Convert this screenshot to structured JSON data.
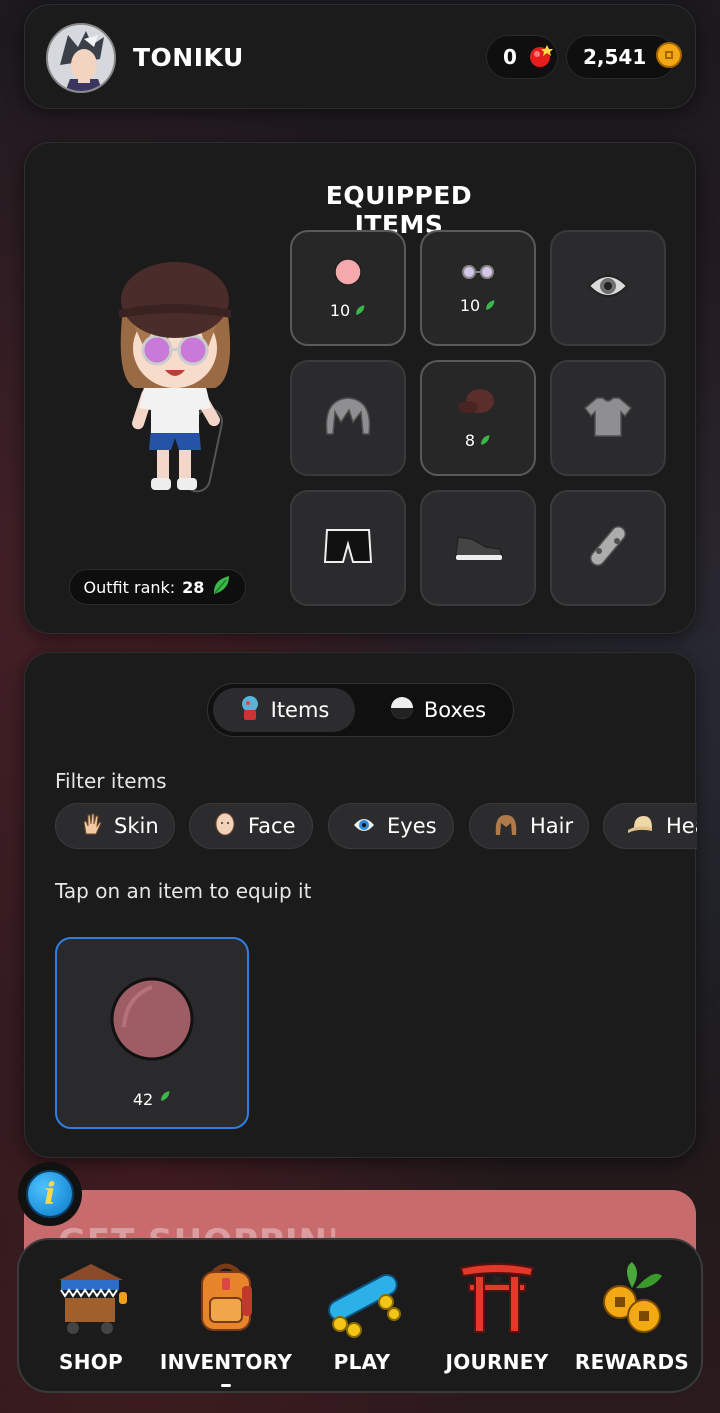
{
  "header": {
    "username": "TONIKU",
    "gems": "0",
    "coins": "2,541"
  },
  "equipped": {
    "title": "EQUIPPED ITEMS",
    "outfit_rank_label": "Outfit rank:",
    "outfit_rank_value": "28",
    "slots": [
      {
        "icon": "skin-circle-icon",
        "count": "10"
      },
      {
        "icon": "glasses-icon",
        "count": "10"
      },
      {
        "icon": "eye-icon",
        "count": ""
      },
      {
        "icon": "hair-icon",
        "count": ""
      },
      {
        "icon": "cap-icon",
        "count": "8"
      },
      {
        "icon": "tshirt-icon",
        "count": ""
      },
      {
        "icon": "shorts-icon",
        "count": ""
      },
      {
        "icon": "sneaker-icon",
        "count": ""
      },
      {
        "icon": "skateboard-icon",
        "count": ""
      }
    ]
  },
  "inventory": {
    "tabs": [
      {
        "label": "Items",
        "active": true
      },
      {
        "label": "Boxes",
        "active": false
      }
    ],
    "filter_label": "Filter items",
    "filters": [
      "Skin",
      "Face",
      "Eyes",
      "Hair",
      "Hea"
    ],
    "tap_hint": "Tap on an item to equip it",
    "items": [
      {
        "icon": "skin-tone-icon",
        "count": "42",
        "color": "#9e5d65"
      }
    ]
  },
  "banner": {
    "text": "GET SHOPPIN'"
  },
  "nav": {
    "items": [
      {
        "label": "SHOP",
        "active": false
      },
      {
        "label": "INVENTORY",
        "active": true
      },
      {
        "label": "PLAY",
        "active": false
      },
      {
        "label": "JOURNEY",
        "active": false
      },
      {
        "label": "REWARDS",
        "active": false
      }
    ]
  },
  "colors": {
    "accent_blue": "#2f7fe0",
    "leaf_green": "#3bb84a",
    "panel": "#1b1b1c"
  }
}
